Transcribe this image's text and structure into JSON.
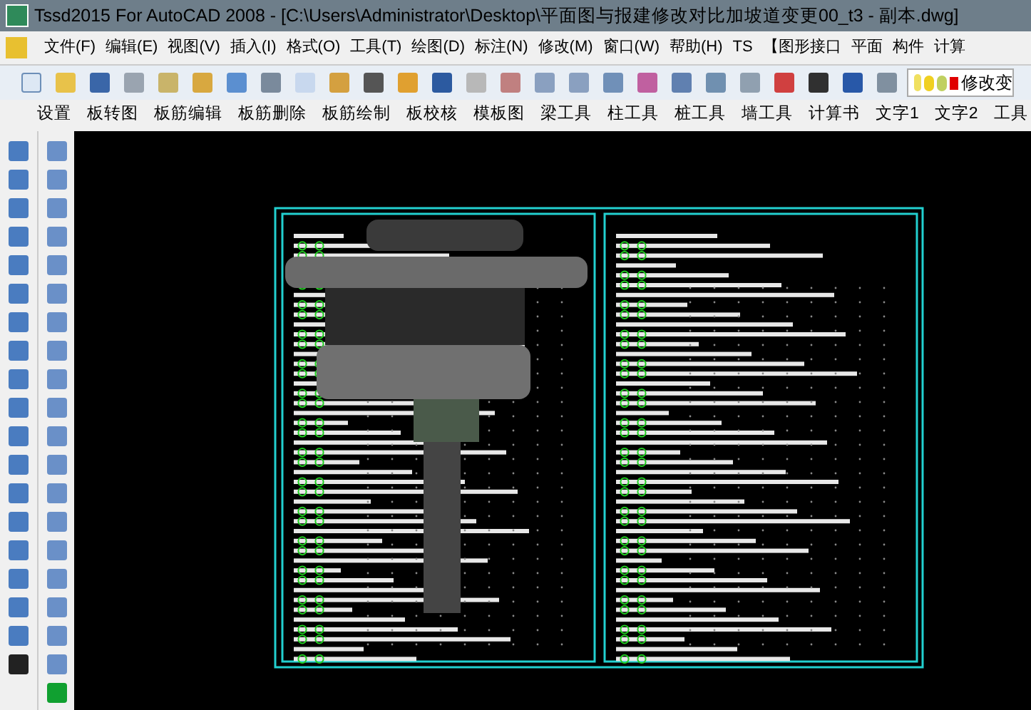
{
  "window": {
    "title": "Tssd2015 For AutoCAD 2008 - [C:\\Users\\Administrator\\Desktop\\平面图与报建修改对比加坡道变更00_t3 - 副本.dwg]"
  },
  "menu": [
    "文件(F)",
    "编辑(E)",
    "视图(V)",
    "插入(I)",
    "格式(O)",
    "工具(T)",
    "绘图(D)",
    "标注(N)",
    "修改(M)",
    "窗口(W)",
    "帮助(H)",
    "TS",
    "【图形接口",
    "平面",
    "构件",
    "计算"
  ],
  "layer_field": {
    "value": "修改变"
  },
  "tssd_menu": [
    "设置",
    "板转图",
    "板筋编辑",
    "板筋删除",
    "板筋绘制",
    "板校核",
    "模板图",
    "梁工具",
    "柱工具",
    "桩工具",
    "墙工具",
    "计算书",
    "文字1",
    "文字2",
    "工具"
  ]
}
